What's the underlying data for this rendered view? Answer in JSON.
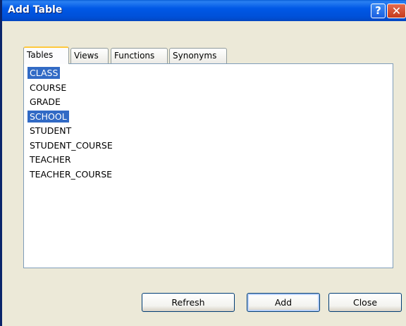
{
  "window": {
    "title": "Add Table",
    "help_glyph": "?",
    "close_glyph": "✕"
  },
  "tabs": [
    {
      "label": "Tables",
      "active": true
    },
    {
      "label": "Views",
      "active": false
    },
    {
      "label": "Functions",
      "active": false
    },
    {
      "label": "Synonyms",
      "active": false
    }
  ],
  "tables": [
    {
      "name": "CLASS",
      "selected": true
    },
    {
      "name": "COURSE",
      "selected": false
    },
    {
      "name": "GRADE",
      "selected": false
    },
    {
      "name": "SCHOOL",
      "selected": true
    },
    {
      "name": "STUDENT",
      "selected": false
    },
    {
      "name": "STUDENT_COURSE",
      "selected": false
    },
    {
      "name": "TEACHER",
      "selected": false
    },
    {
      "name": "TEACHER_COURSE",
      "selected": false
    }
  ],
  "buttons": {
    "refresh": "Refresh",
    "add": "Add",
    "close": "Close"
  },
  "colors": {
    "titlebar": "#0058E6",
    "selection": "#316AC5",
    "dialog_bg": "#ECE9D8"
  }
}
